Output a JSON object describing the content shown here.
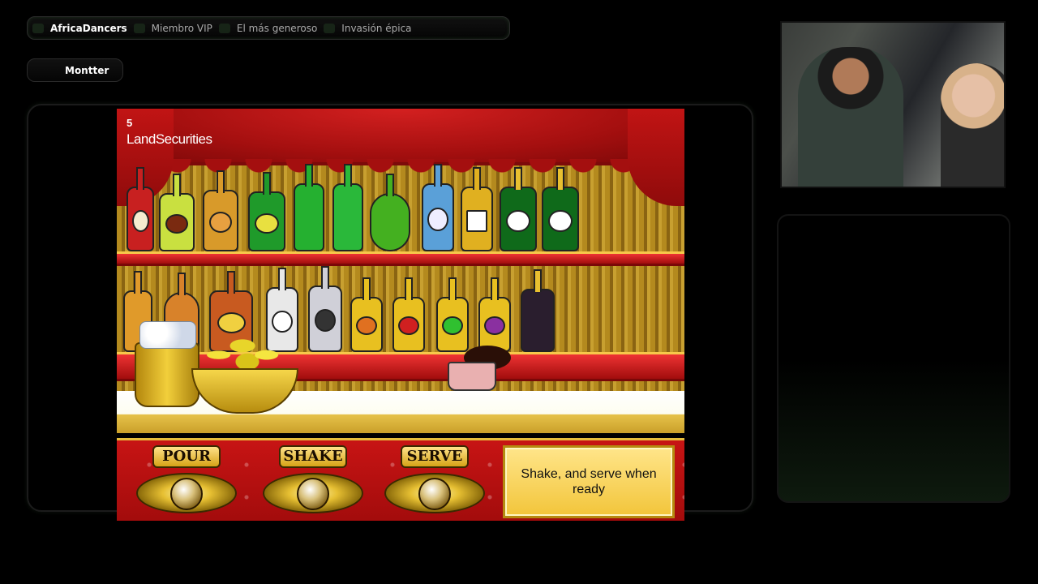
{
  "badges": [
    {
      "label": "AfricaDancers",
      "active": true
    },
    {
      "label": "Miembro VIP",
      "active": false
    },
    {
      "label": "El más generoso",
      "active": false
    },
    {
      "label": "Invasión épica",
      "active": false
    }
  ],
  "user": {
    "name": "Montter"
  },
  "game": {
    "logo_mark": "5",
    "logo_text": "LandSecurities",
    "controls": {
      "pour": "POUR",
      "shake": "SHAKE",
      "serve": "SERVE"
    },
    "message": "Shake, and serve when ready"
  },
  "colors": {
    "accent_green": "#1c2e1c",
    "curtain_red": "#b31212",
    "gold": "#e6be3c"
  }
}
